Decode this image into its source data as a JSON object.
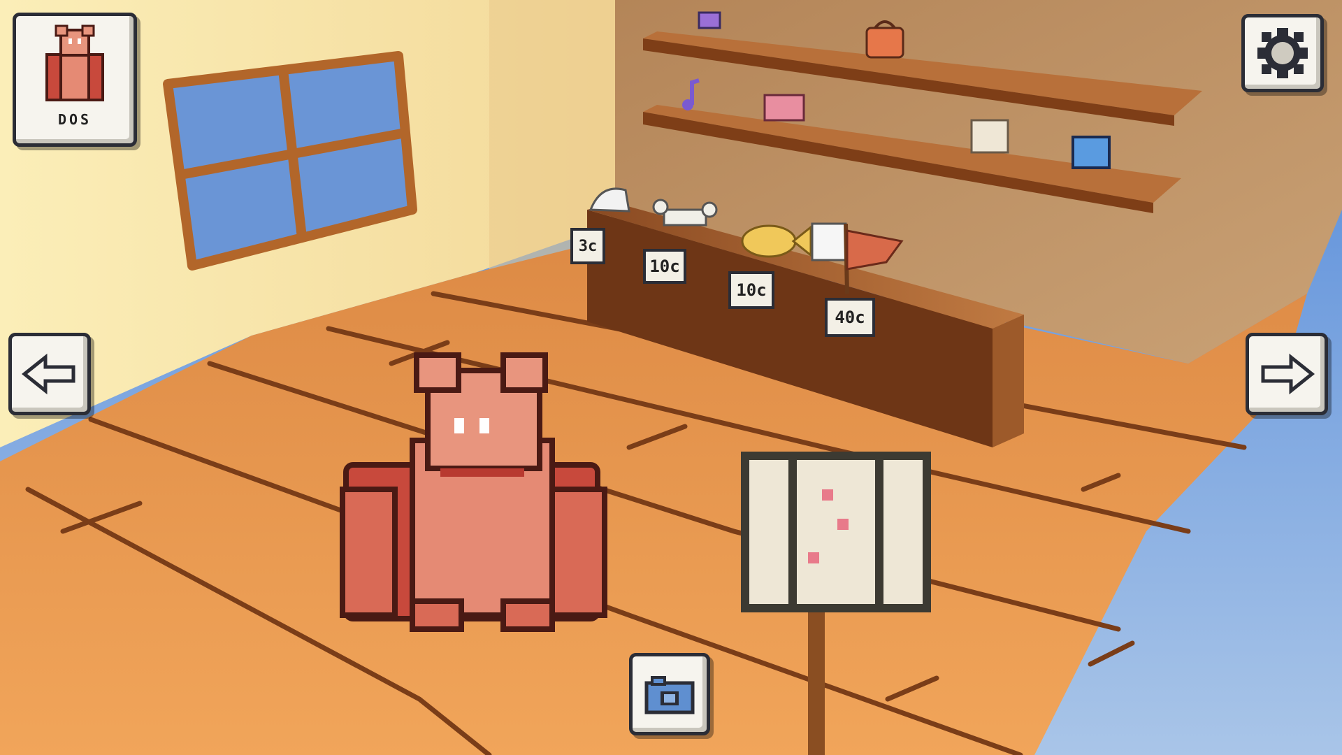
{
  "pet": {
    "name": "DOS",
    "portrait_icon": "gorilla-portrait-icon"
  },
  "controls": {
    "settings_icon": "gear-icon",
    "left_icon": "arrow-left-icon",
    "right_icon": "arrow-right-icon",
    "camera_icon": "camera-icon"
  },
  "shop_items": [
    {
      "name": "sock-hat",
      "price": "3c"
    },
    {
      "name": "bone",
      "price": "10c"
    },
    {
      "name": "fish",
      "price": "10c"
    },
    {
      "name": "flag-cat",
      "price": "40c"
    }
  ],
  "colors": {
    "floor": "#e8974a",
    "wall_left": "#f8e7a8",
    "wall_back": "#bf9565",
    "sky": "#6d9ad8",
    "wood": "#b06a30",
    "ui_panel": "#f6f4ee",
    "ui_border": "#2b2d36"
  }
}
